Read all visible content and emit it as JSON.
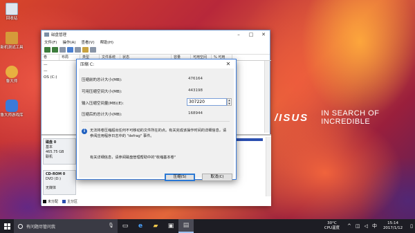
{
  "desktop": {
    "icons": [
      {
        "label": "回收站",
        "color": "#dfe7ef"
      },
      {
        "label": "新机测试工具",
        "color": "#d59a3a"
      },
      {
        "label": "鲁大师",
        "color": "#e8b040"
      },
      {
        "label": "鲁大师游戏库",
        "color": "#3b7ad8"
      }
    ],
    "brand": {
      "logo": "/ISUS",
      "slogan": "IN SEARCH OF INCREDIBLE"
    }
  },
  "window": {
    "title": "磁盘管理",
    "menu": [
      "文件(F)",
      "操作(A)",
      "查看(V)",
      "帮助(H)"
    ],
    "columns": [
      "卷",
      "布局",
      "类型",
      "文件系统",
      "状态",
      "容量",
      "可用空间",
      "% 可用"
    ],
    "volumes": [
      "—",
      "—",
      "OS (C:)"
    ],
    "disk0": {
      "name": "磁盘 0",
      "type": "基本",
      "size": "465.75 GB",
      "status": "联机"
    },
    "cdrom": {
      "name": "CD-ROM 0",
      "type": "DVD (D:)",
      "status": "无媒体"
    },
    "legend": [
      {
        "label": "未分配",
        "color": "#111111"
      },
      {
        "label": "主分区",
        "color": "#2b4fb0"
      }
    ]
  },
  "dialog": {
    "title": "压缩 C:",
    "fields": [
      {
        "label": "压缩前的总计大小(MB):",
        "value": "476164"
      },
      {
        "label": "可用压缩空间大小(MB):",
        "value": "443198"
      },
      {
        "label": "输入压缩空间量(MB)(E):",
        "value": "307220"
      },
      {
        "label": "压缩后的总计大小(MB):",
        "value": "168944"
      }
    ],
    "info_line1": "无法将卷压缩超出任何不可移动的文件所在的点。有关完成该操作时间的详细信息，请",
    "info_line2": "参阅应用程序日志中的 \"defrag\" 事件。",
    "help_text": "有关详细信息，请参阅磁盘管理帮助中的\"收缩基本卷\"",
    "shrink_button": "压缩(S)",
    "cancel_button": "取消(C)"
  },
  "taskbar": {
    "search_placeholder": "有问题尽管问我",
    "weather": {
      "temp": "30°C",
      "label": "CPU温度"
    },
    "clock": {
      "time": "15:14",
      "date": "2017/1/12"
    }
  }
}
